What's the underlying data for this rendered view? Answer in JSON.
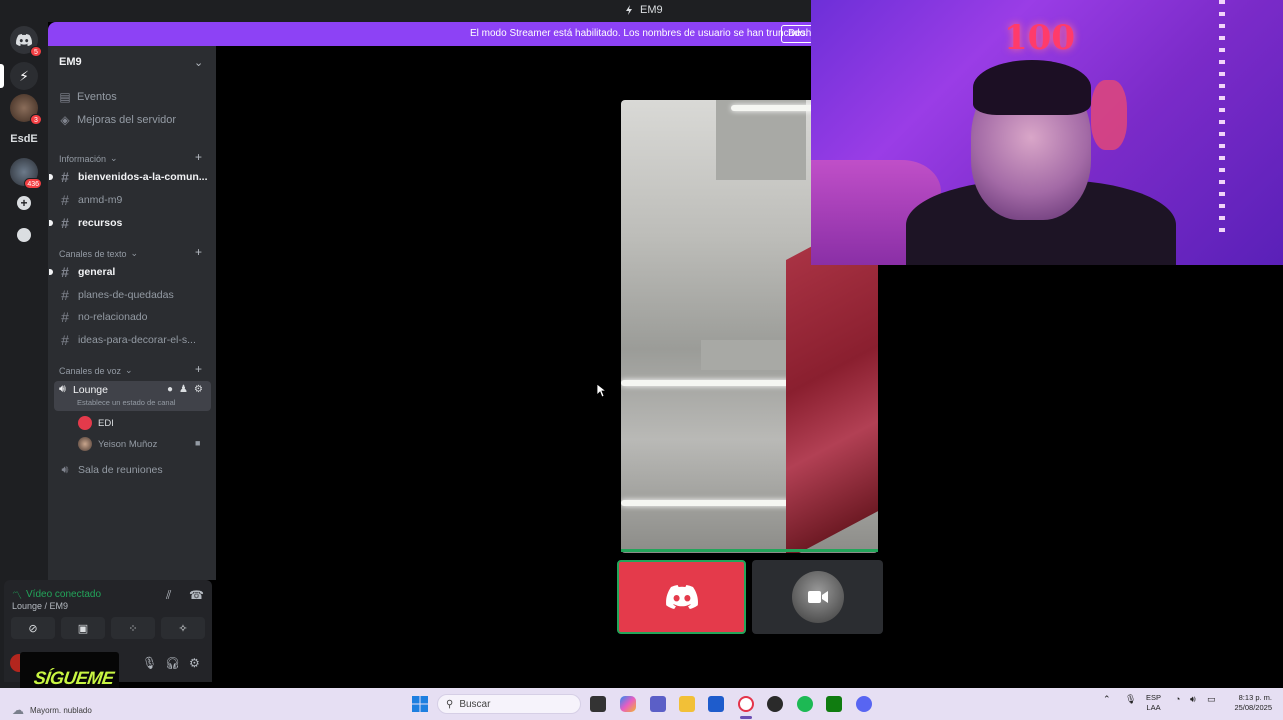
{
  "app": {
    "window_title": "EM9",
    "streamer_banner": "El modo Streamer está habilitado. Los nombres de usuario se han truncado.",
    "streamer_banner_action": "Desha"
  },
  "server_rail": {
    "items": [
      {
        "name": "discord-home",
        "badge": "5"
      },
      {
        "name": "server-2",
        "badge": ""
      },
      {
        "name": "server-3",
        "badge": "3"
      },
      {
        "name": "server-esde",
        "label": "EsdE"
      },
      {
        "name": "server-5",
        "badge": "436"
      }
    ]
  },
  "sidebar": {
    "server_name": "EM9",
    "top_items": [
      {
        "label": "Eventos",
        "icon": "calendar-icon"
      },
      {
        "label": "Mejoras del servidor",
        "icon": "boost-icon"
      }
    ],
    "categories": [
      {
        "label": "Información",
        "channels": [
          {
            "label": "bienvenidos-a-la-comun...",
            "unread": true
          },
          {
            "label": "anmd-m9",
            "unread": false
          },
          {
            "label": "recursos",
            "unread": true
          }
        ]
      },
      {
        "label": "Canales de texto",
        "channels": [
          {
            "label": "general",
            "unread": true
          },
          {
            "label": "planes-de-quedadas",
            "unread": false
          },
          {
            "label": "no-relacionado",
            "unread": false
          },
          {
            "label": "ideas-para-decorar-el-s...",
            "unread": false
          }
        ]
      },
      {
        "label": "Canales de voz",
        "voice_channel": {
          "label": "Lounge",
          "status": "Establece un estado de canal",
          "members": [
            {
              "name": "EDI",
              "camera": false
            },
            {
              "name": "Yeison Muñoz",
              "camera": true
            }
          ]
        },
        "other_voice": "Sala de reuniones"
      }
    ]
  },
  "voice_panel": {
    "status": "Vídeo conectado",
    "location": "Lounge / EM9"
  },
  "overlay": {
    "follow_text": "SÍGUEME"
  },
  "webcam": {
    "balloon_text": "100"
  },
  "taskbar": {
    "weather": "Mayorm. nublado",
    "search_placeholder": "Buscar",
    "lang_line1": "ESP",
    "lang_line2": "LAA",
    "time": "8:13 p. m.",
    "date": "25/08/2025"
  },
  "colors": {
    "banner": "#8d42f5",
    "speaking": "#23a55a",
    "discord_tile": "#e43a4b"
  }
}
